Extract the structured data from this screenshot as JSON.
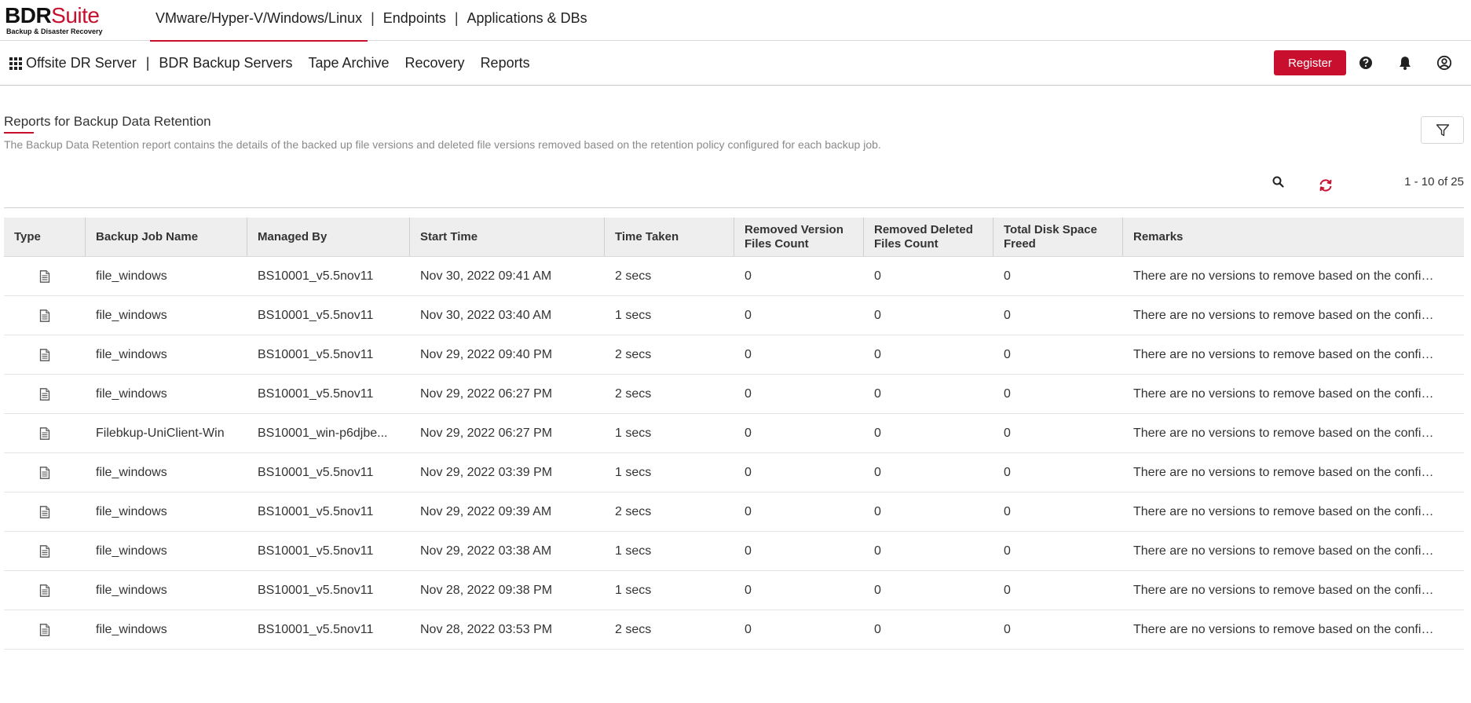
{
  "app": {
    "logo_main_bdr": "BDR",
    "logo_main_suite": "Suite",
    "logo_sub": "Backup & Disaster Recovery"
  },
  "product_nav": [
    {
      "label": "VMware/Hyper-V/Windows/Linux",
      "active": true
    },
    {
      "label": "Endpoints",
      "active": false
    },
    {
      "label": "Applications & DBs",
      "active": false
    }
  ],
  "product_nav_separator": "|",
  "sub_nav": {
    "current": "Offsite DR Server",
    "separator": "|",
    "items": [
      "BDR Backup Servers",
      "Tape Archive",
      "Recovery",
      "Reports"
    ]
  },
  "header": {
    "register_label": "Register",
    "help_icon": "help-circle-icon",
    "bell_icon": "bell-icon",
    "user_icon": "user-circle-icon"
  },
  "page": {
    "title": "Reports for Backup Data Retention",
    "description": "The Backup Data Retention report contains the details of the backed up file versions and deleted file versions removed based on the retention policy configured for each backup job."
  },
  "toolbar": {
    "pager_text": "1 - 10 of 25"
  },
  "colors": {
    "accent": "#c8102e",
    "header_bg": "#eeeeee"
  },
  "table": {
    "headers": [
      [
        "Type"
      ],
      [
        "Backup Job Name"
      ],
      [
        "Managed By"
      ],
      [
        "Start Time"
      ],
      [
        "Time Taken"
      ],
      [
        "Removed Version",
        "Files Count"
      ],
      [
        "Removed Deleted",
        "Files Count"
      ],
      [
        "Total Disk Space",
        "Freed"
      ],
      [
        "Remarks"
      ]
    ],
    "rows": [
      {
        "job": "file_windows",
        "managed": "BS10001_v5.5nov11",
        "start": "Nov 30, 2022 09:41 AM",
        "taken": "2 secs",
        "rv": "0",
        "rd": "0",
        "freed": "0",
        "remarks": "There are no versions to remove based on the configu..."
      },
      {
        "job": "file_windows",
        "managed": "BS10001_v5.5nov11",
        "start": "Nov 30, 2022 03:40 AM",
        "taken": "1 secs",
        "rv": "0",
        "rd": "0",
        "freed": "0",
        "remarks": "There are no versions to remove based on the configu..."
      },
      {
        "job": "file_windows",
        "managed": "BS10001_v5.5nov11",
        "start": "Nov 29, 2022 09:40 PM",
        "taken": "2 secs",
        "rv": "0",
        "rd": "0",
        "freed": "0",
        "remarks": "There are no versions to remove based on the configu..."
      },
      {
        "job": "file_windows",
        "managed": "BS10001_v5.5nov11",
        "start": "Nov 29, 2022 06:27 PM",
        "taken": "2 secs",
        "rv": "0",
        "rd": "0",
        "freed": "0",
        "remarks": "There are no versions to remove based on the configu..."
      },
      {
        "job": "Filebkup-UniClient-Win",
        "managed": "BS10001_win-p6djbe...",
        "start": "Nov 29, 2022 06:27 PM",
        "taken": "1 secs",
        "rv": "0",
        "rd": "0",
        "freed": "0",
        "remarks": "There are no versions to remove based on the configu..."
      },
      {
        "job": "file_windows",
        "managed": "BS10001_v5.5nov11",
        "start": "Nov 29, 2022 03:39 PM",
        "taken": "1 secs",
        "rv": "0",
        "rd": "0",
        "freed": "0",
        "remarks": "There are no versions to remove based on the configu..."
      },
      {
        "job": "file_windows",
        "managed": "BS10001_v5.5nov11",
        "start": "Nov 29, 2022 09:39 AM",
        "taken": "2 secs",
        "rv": "0",
        "rd": "0",
        "freed": "0",
        "remarks": "There are no versions to remove based on the configu..."
      },
      {
        "job": "file_windows",
        "managed": "BS10001_v5.5nov11",
        "start": "Nov 29, 2022 03:38 AM",
        "taken": "1 secs",
        "rv": "0",
        "rd": "0",
        "freed": "0",
        "remarks": "There are no versions to remove based on the configu..."
      },
      {
        "job": "file_windows",
        "managed": "BS10001_v5.5nov11",
        "start": "Nov 28, 2022 09:38 PM",
        "taken": "1 secs",
        "rv": "0",
        "rd": "0",
        "freed": "0",
        "remarks": "There are no versions to remove based on the configu..."
      },
      {
        "job": "file_windows",
        "managed": "BS10001_v5.5nov11",
        "start": "Nov 28, 2022 03:53 PM",
        "taken": "2 secs",
        "rv": "0",
        "rd": "0",
        "freed": "0",
        "remarks": "There are no versions to remove based on the configu..."
      }
    ]
  }
}
